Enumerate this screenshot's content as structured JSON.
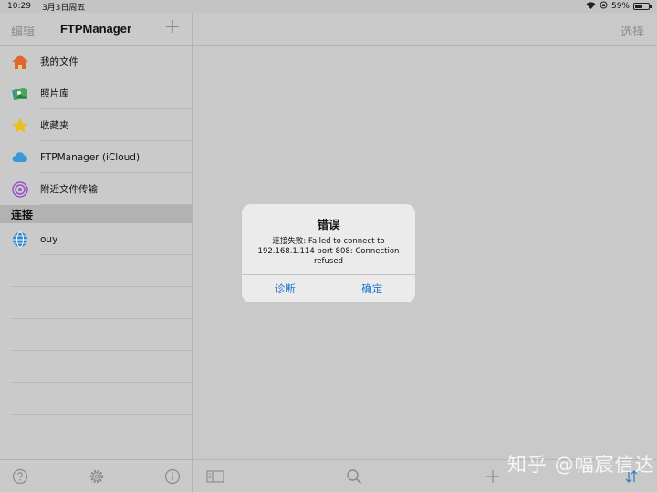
{
  "status_bar": {
    "time": "10:29",
    "date": "3月3日周五",
    "battery_percent": "59%",
    "battery_level": 0.59
  },
  "sidebar": {
    "edit_label": "编辑",
    "title": "FTPManager",
    "add_symbol": "+",
    "items": [
      {
        "label": "我的文件",
        "icon": "home-icon"
      },
      {
        "label": "照片库",
        "icon": "photos-icon"
      },
      {
        "label": "收藏夹",
        "icon": "star-icon"
      },
      {
        "label": "FTPManager (iCloud)",
        "icon": "cloud-icon"
      },
      {
        "label": "附近文件传输",
        "icon": "airdrop-icon"
      }
    ],
    "section_header": "连接",
    "connections": [
      {
        "label": "ouy",
        "icon": "globe-icon"
      }
    ],
    "toolbar": [
      "help-icon",
      "settings-icon",
      "info-icon"
    ]
  },
  "detail": {
    "select_label": "选择",
    "toolbar": [
      "sidebar-toggle-icon",
      "search-icon",
      "add-icon",
      "sort-icon"
    ]
  },
  "dialog": {
    "title": "错误",
    "message": "连接失败: Failed to connect to 192.168.1.114 port 808: Connection refused",
    "buttons": [
      {
        "label": "诊断"
      },
      {
        "label": "确定"
      }
    ]
  },
  "watermark": "知乎 @幅宸信达",
  "colors": {
    "accent": "#1a73c9",
    "background": "#c9c9c9",
    "dialog": "#ebebeb"
  }
}
